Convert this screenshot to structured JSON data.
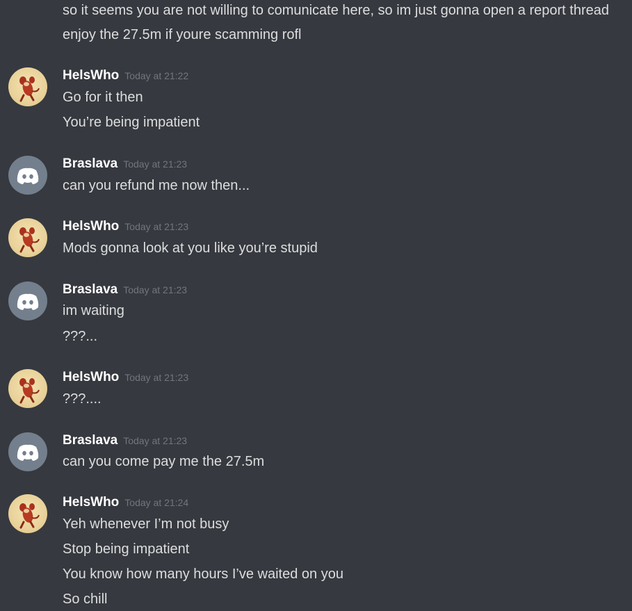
{
  "continuation": [
    "so it seems you are not willing to comunicate here, so im just gonna open a report thread",
    "enjoy the 27.5m if youre scamming rofl"
  ],
  "groups": [
    {
      "username": "HelsWho",
      "timestamp": "Today at 21:22",
      "avatar": "jerry-mouse-icon",
      "lines": [
        "Go for it then",
        "You’re being impatient"
      ]
    },
    {
      "username": "Braslava",
      "timestamp": "Today at 21:23",
      "avatar": "discord-default-avatar-icon",
      "lines": [
        "can you refund me now then..."
      ]
    },
    {
      "username": "HelsWho",
      "timestamp": "Today at 21:23",
      "avatar": "jerry-mouse-icon",
      "lines": [
        "Mods gonna look at you like you’re stupid"
      ]
    },
    {
      "username": "Braslava",
      "timestamp": "Today at 21:23",
      "avatar": "discord-default-avatar-icon",
      "lines": [
        "im waiting",
        "???..."
      ]
    },
    {
      "username": "HelsWho",
      "timestamp": "Today at 21:23",
      "avatar": "jerry-mouse-icon",
      "lines": [
        "???...."
      ]
    },
    {
      "username": "Braslava",
      "timestamp": "Today at 21:23",
      "avatar": "discord-default-avatar-icon",
      "lines": [
        "can you come pay me the 27.5m"
      ]
    },
    {
      "username": "HelsWho",
      "timestamp": "Today at 21:24",
      "avatar": "jerry-mouse-icon",
      "lines": [
        "Yeh whenever I’m not busy",
        "Stop being impatient",
        "You know how many hours I’ve waited on you",
        "So chill"
      ]
    }
  ],
  "colors": {
    "background": "#36393f",
    "username": "#ffffff",
    "message_text": "#dcddde",
    "timestamp": "#72767d",
    "default_avatar": "#747f8d"
  }
}
